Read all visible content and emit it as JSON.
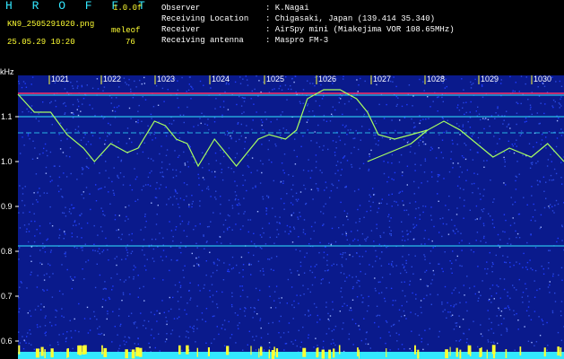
{
  "header": {
    "title": "H R O F F T",
    "version": "1.0.0f",
    "filename": "KN9_2505291020.png",
    "meleof_label": "meleof",
    "datetime": "25.05.29 10:20",
    "meleof_value": "76"
  },
  "meta": [
    {
      "label": "Observer",
      "value": ": K.Nagai"
    },
    {
      "label": "Receiving Location",
      "value": ": Chigasaki, Japan (139.414 35.340)"
    },
    {
      "label": "Receiver",
      "value": ": AirSpy mini (Miakejima VOR 108.65MHz)"
    },
    {
      "label": "Receiving antenna",
      "value": ": Maspro FM-3"
    }
  ],
  "axis": {
    "y_unit": "kHz",
    "y_ticks": [
      "1.1",
      "1.0",
      "0.9",
      "0.8",
      "0.7",
      "0.6"
    ],
    "x_ticks": [
      "1021",
      "1022",
      "1023",
      "1024",
      "1025",
      "1026",
      "1027",
      "1028",
      "1029",
      "1030"
    ]
  },
  "colors": {
    "background": "#0a1a8c",
    "noise": "#1e3cff",
    "trace": "#a8ff60",
    "carrier": "#33e8ff",
    "tick_box": "#ffff33",
    "red_line": "#ff3366"
  }
}
